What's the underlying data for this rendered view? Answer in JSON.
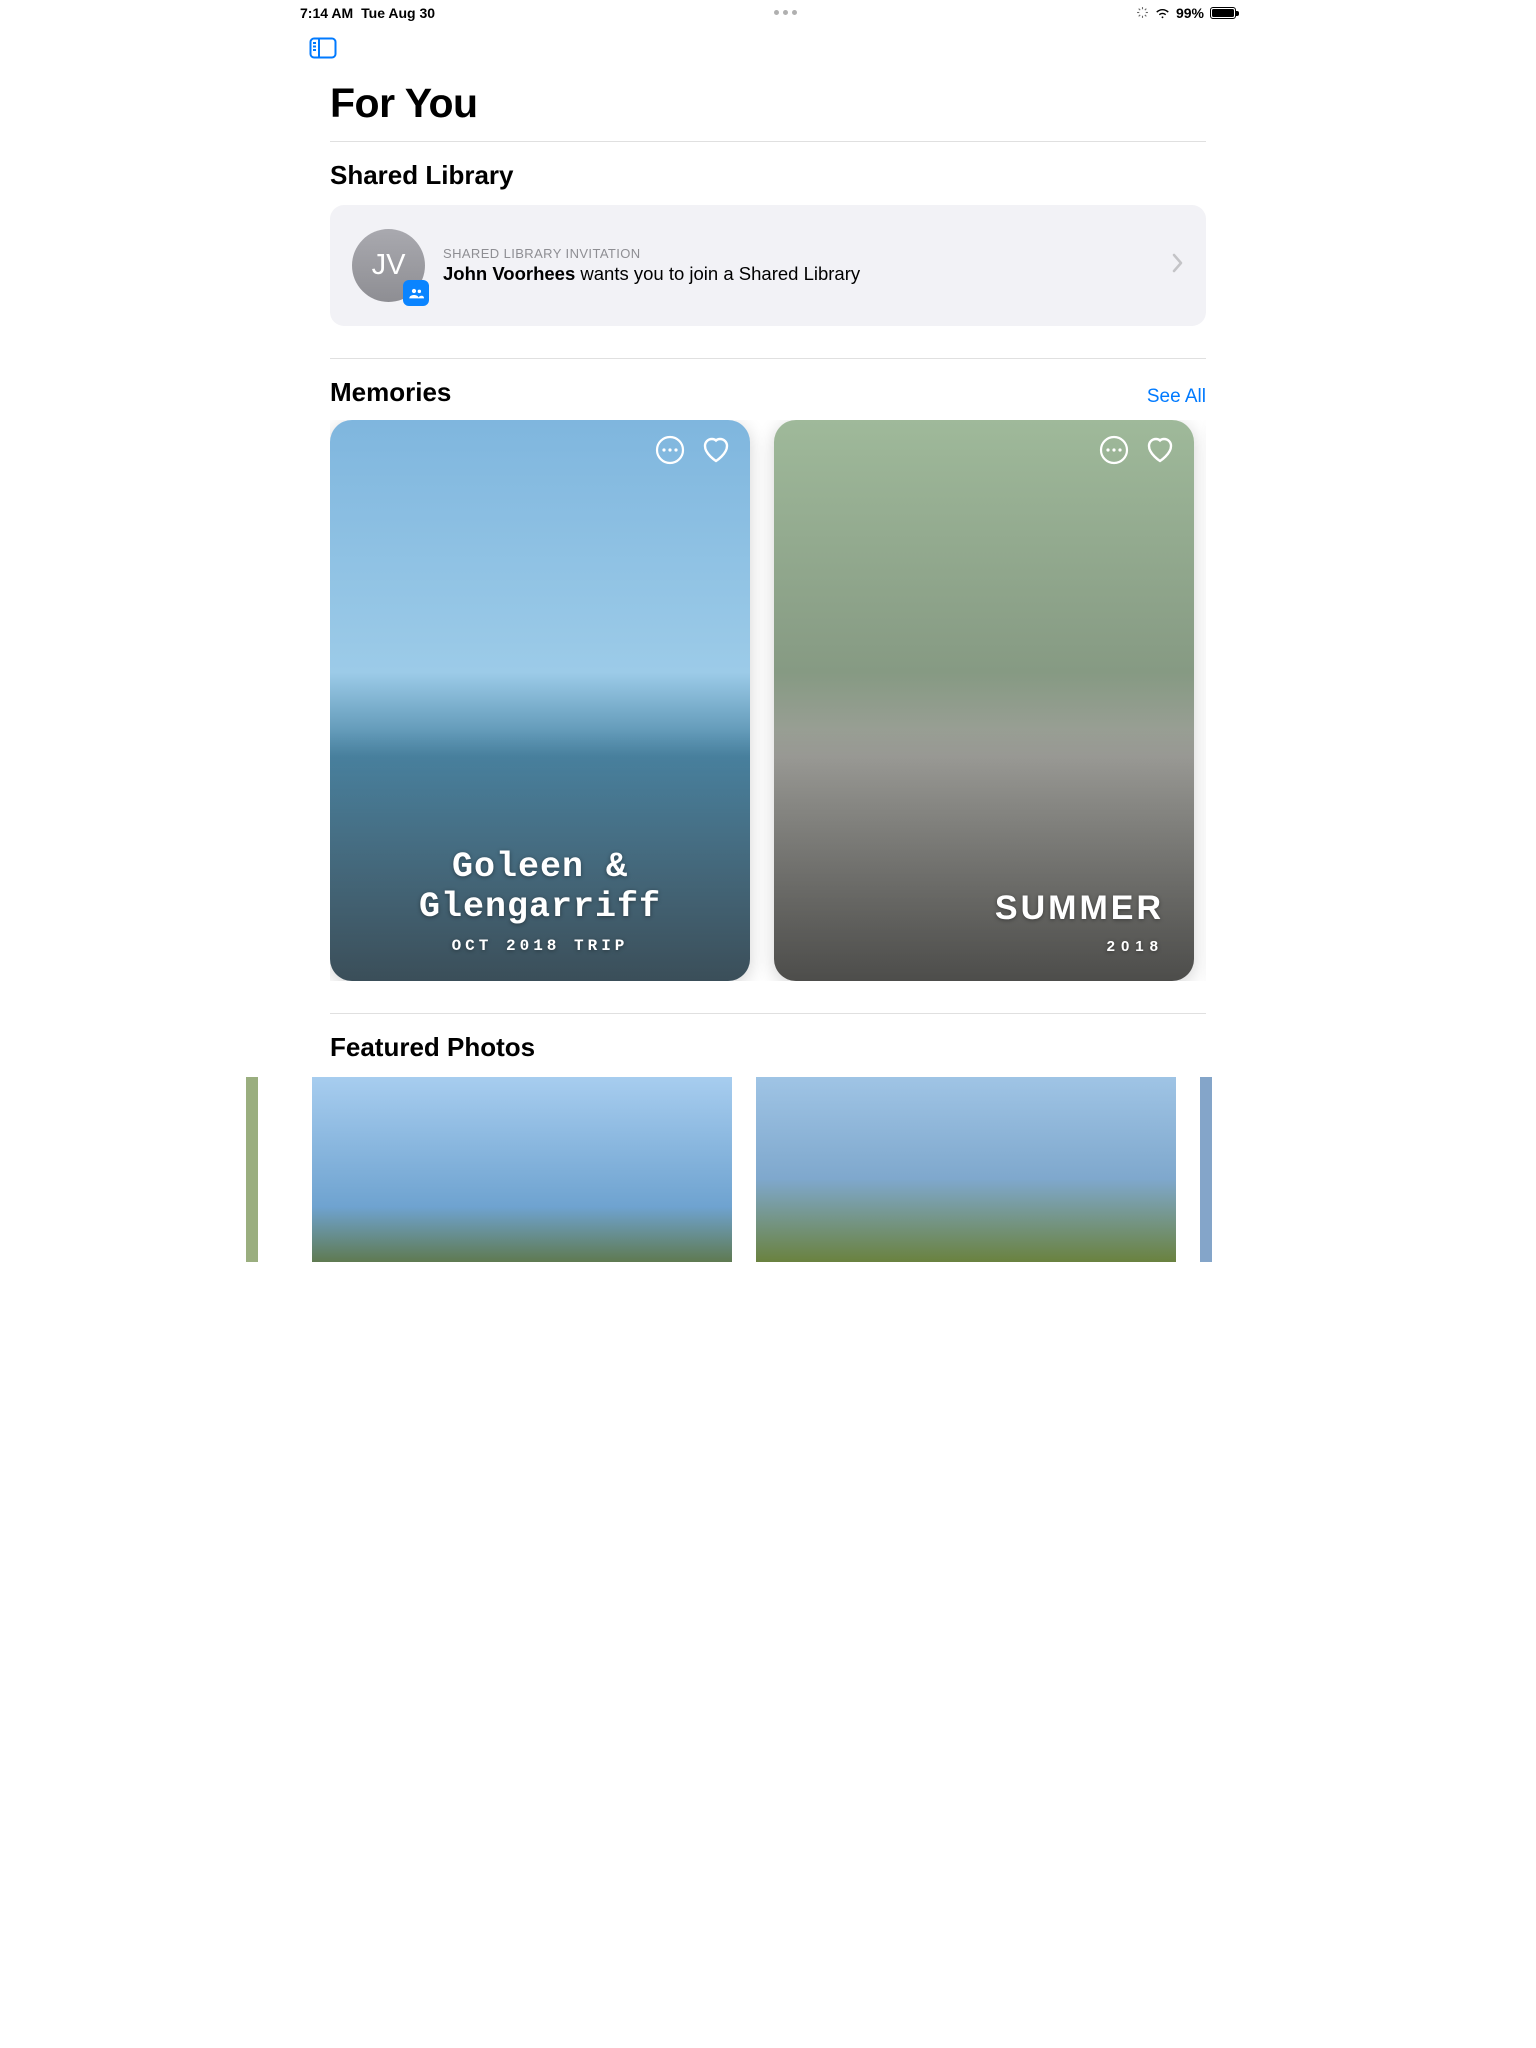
{
  "status": {
    "time": "7:14 AM",
    "date": "Tue Aug 30",
    "battery_pct": "99%"
  },
  "page": {
    "title": "For You"
  },
  "shared_library": {
    "section_title": "Shared Library",
    "eyebrow": "SHARED LIBRARY INVITATION",
    "inviter_name": "John Voorhees",
    "invite_rest": " wants you to join a Shared Library",
    "avatar_initials": "JV"
  },
  "memories": {
    "section_title": "Memories",
    "see_all": "See All",
    "cards": [
      {
        "title_line1": "Goleen &",
        "title_line2": "Glengarriff",
        "sub": "OCT 2018 TRIP"
      },
      {
        "title_line1": "SUMMER",
        "title_line2": "",
        "sub": "2018"
      }
    ]
  },
  "featured": {
    "section_title": "Featured Photos"
  }
}
